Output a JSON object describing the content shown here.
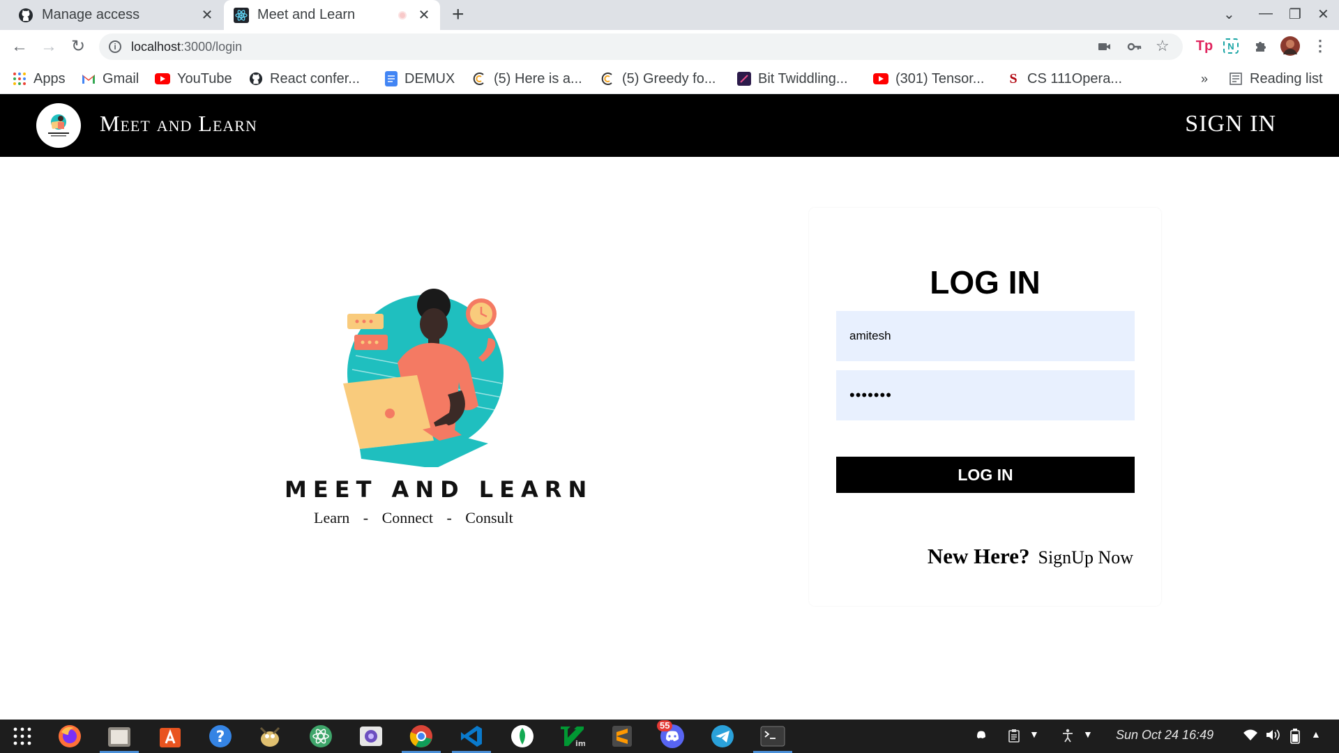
{
  "browser": {
    "tabs": [
      {
        "title": "Manage access",
        "icon": "github-icon"
      },
      {
        "title": "Meet and Learn",
        "icon": "react-icon"
      }
    ],
    "url_host": "localhost",
    "url_path": ":3000/login",
    "bookmarks": [
      {
        "label": "Apps",
        "icon": "apps-grid-icon"
      },
      {
        "label": "Gmail",
        "icon": "gmail-icon"
      },
      {
        "label": "YouTube",
        "icon": "youtube-icon"
      },
      {
        "label": "React confer...",
        "icon": "github-icon"
      },
      {
        "label": "DEMUX",
        "icon": "docs-icon"
      },
      {
        "label": "(5) Here is a...",
        "icon": "codeforces-icon"
      },
      {
        "label": "(5) Greedy fo...",
        "icon": "codeforces-icon"
      },
      {
        "label": "Bit Twiddling...",
        "icon": "site-icon"
      },
      {
        "label": "(301) Tensor...",
        "icon": "youtube-icon"
      },
      {
        "label": "CS 111Opera...",
        "icon": "stanford-icon"
      }
    ],
    "overflow_label": "»",
    "reading_list": "Reading list",
    "ext_tp": "Tp",
    "ext_n": "N"
  },
  "app": {
    "title": "Meet and Learn",
    "signin_link": "SIGN IN",
    "brand_name": "MEET AND LEARN",
    "tagline": [
      "Learn",
      "-",
      "Connect",
      "-",
      "Consult"
    ],
    "login": {
      "heading": "LOG IN",
      "username_value": "amitesh",
      "password_value": "•••••••",
      "button_label": "LOG IN",
      "signup_question": "New Here?",
      "signup_link": "SignUp Now"
    }
  },
  "taskbar": {
    "clock": "Sun Oct 24  16:49",
    "discord_badge": "55",
    "apps": [
      "app-grid-icon",
      "firefox-icon",
      "files-icon",
      "software-center-icon",
      "help-icon",
      "gimp-icon",
      "atom-icon",
      "screenshot-icon",
      "chrome-icon",
      "vscode-icon",
      "mongodb-icon",
      "vim-icon",
      "sublime-icon",
      "discord-icon",
      "telegram-icon",
      "terminal-icon"
    ]
  },
  "colors": {
    "header_bg": "#000000",
    "input_bg": "#e8f0fe",
    "button_bg": "#000000",
    "teal": "#1fbfbf",
    "coral": "#f47a63",
    "laptop": "#f9cb7c"
  }
}
